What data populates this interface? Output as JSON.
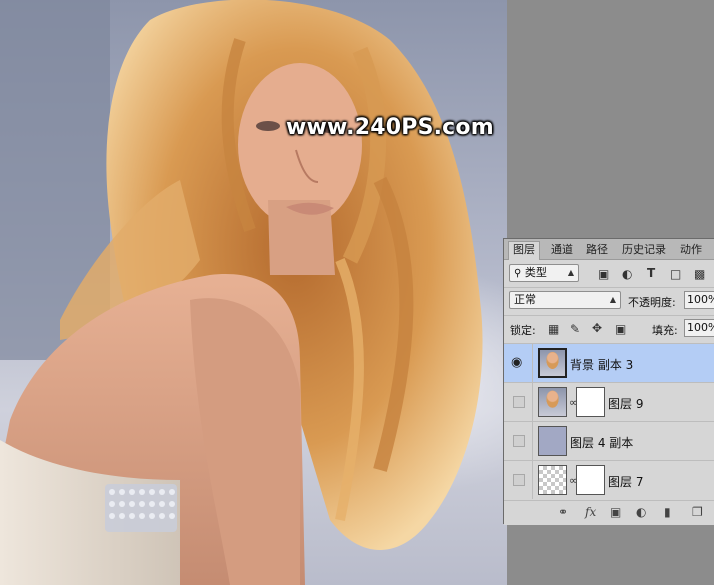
{
  "watermark": "www.240PS.com",
  "panel": {
    "tabs": [
      "图层",
      "通道",
      "路径",
      "历史记录",
      "动作"
    ],
    "filter": {
      "kind_label": "类型",
      "icons": [
        "image-filter-icon",
        "adjustment-filter-icon",
        "type-filter-icon",
        "shape-filter-icon",
        "smart-object-filter-icon"
      ]
    },
    "blend_mode": "正常",
    "opacity_label": "不透明度:",
    "opacity_value": "100%",
    "lock_label": "锁定:",
    "fill_label": "填充:",
    "fill_value": "100%",
    "layers": [
      {
        "name": "背景 副本 3",
        "visible": true,
        "selected": true,
        "thumb": "photo",
        "mask": false
      },
      {
        "name": "图层 9",
        "visible": false,
        "selected": false,
        "thumb": "photo",
        "mask": true
      },
      {
        "name": "图层 4 副本",
        "visible": false,
        "selected": false,
        "thumb": "solid",
        "mask": false
      },
      {
        "name": "图层 7",
        "visible": false,
        "selected": false,
        "thumb": "checker",
        "mask": true
      }
    ],
    "bottom_icons": [
      "link-layers-icon",
      "fx-icon",
      "add-mask-icon",
      "adjustment-layer-icon",
      "new-group-icon",
      "new-layer-icon"
    ],
    "fx_label": "fx"
  },
  "colors": {
    "selected_row": "#b4cdf5",
    "panel_bg": "#d6d6d6",
    "workspace": "#8c8c8c"
  }
}
